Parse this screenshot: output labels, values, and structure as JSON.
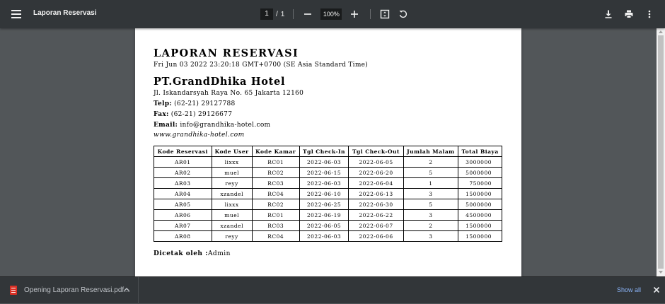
{
  "toolbar": {
    "title": "Laporan Reservasi",
    "page_current": "1",
    "page_separator": "/",
    "page_total": "1",
    "zoom": "100%"
  },
  "report": {
    "title": "LAPORAN RESERVASI",
    "date": "Fri Jun 03 2022 23:20:18 GMT+0700 (SE Asia Standard Time)",
    "company": "PT.GrandDhika Hotel",
    "address": "Jl. Iskandarsyah Raya No. 65 Jakarta 12160",
    "telp_label": "Telp:",
    "telp": "(62-21) 29127788",
    "fax_label": "Fax:",
    "fax": "(62-21) 29126677",
    "email_label": "Email:",
    "email": "info@grandhika-hotel.com",
    "website": "www.grandhika-hotel.com",
    "printed_label": "Dicetak oleh :",
    "printed_by": "Admin"
  },
  "table": {
    "headers": [
      "Kode Reservasi",
      "Kode User",
      "Kode Kamar",
      "Tgl Check-In",
      "Tgl Check-Out",
      "Jumlah Malam",
      "Total Biaya"
    ],
    "rows": [
      [
        "AR01",
        "lixxx",
        "RC01",
        "2022-06-03",
        "2022-06-05",
        "2",
        "3000000"
      ],
      [
        "AR02",
        "muel",
        "RC02",
        "2022-06-15",
        "2022-06-20",
        "5",
        "5000000"
      ],
      [
        "AR03",
        "reyy",
        "RC03",
        "2022-06-03",
        "2022-06-04",
        "1",
        "750000"
      ],
      [
        "AR04",
        "xzandel",
        "RC04",
        "2022-06-10",
        "2022-06-13",
        "3",
        "1500000"
      ],
      [
        "AR05",
        "lixxx",
        "RC02",
        "2022-06-25",
        "2022-06-30",
        "5",
        "5000000"
      ],
      [
        "AR06",
        "muel",
        "RC01",
        "2022-06-19",
        "2022-06-22",
        "3",
        "4500000"
      ],
      [
        "AR07",
        "xzandel",
        "RC03",
        "2022-06-05",
        "2022-06-07",
        "2",
        "1500000"
      ],
      [
        "AR08",
        "reyy",
        "RC04",
        "2022-06-03",
        "2022-06-06",
        "3",
        "1500000"
      ]
    ]
  },
  "download_bar": {
    "file_label": "Opening Laporan Reservasi.pdf...",
    "show_all": "Show all"
  },
  "icons": [
    "menu-icon",
    "zoom-out-icon",
    "zoom-in-icon",
    "fit-page-icon",
    "rotate-icon",
    "download-icon",
    "print-icon",
    "more-icon",
    "pdf-file-icon",
    "chevron-up-icon",
    "close-icon"
  ]
}
